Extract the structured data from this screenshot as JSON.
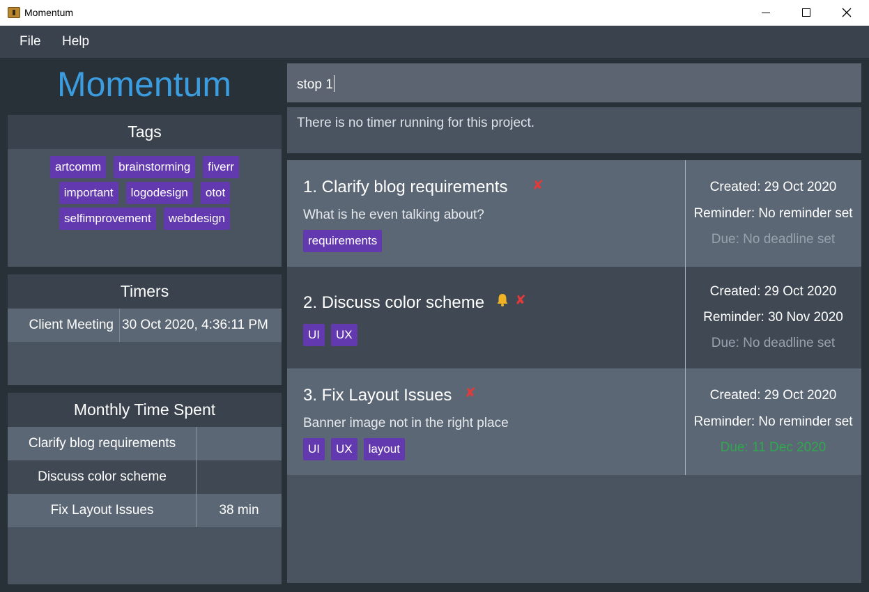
{
  "window": {
    "title": "Momentum"
  },
  "menu": {
    "items": [
      "File",
      "Help"
    ]
  },
  "brand": "Momentum",
  "tags_panel": {
    "title": "Tags",
    "rows": [
      [
        "artcomm",
        "brainstorming",
        "fiverr"
      ],
      [
        "important",
        "logodesign",
        "otot"
      ],
      [
        "selfimprovement",
        "webdesign"
      ]
    ]
  },
  "timers_panel": {
    "title": "Timers",
    "rows": [
      {
        "name": "Client Meeting",
        "time": "30 Oct 2020, 4:36:11 PM"
      }
    ]
  },
  "monthly_panel": {
    "title": "Monthly Time Spent",
    "rows": [
      {
        "name": "Clarify blog requirements",
        "time": ""
      },
      {
        "name": "Discuss color scheme",
        "time": ""
      },
      {
        "name": "Fix Layout Issues",
        "time": "38 min"
      }
    ]
  },
  "command": {
    "value": "stop 1"
  },
  "result": {
    "text": "There is no timer running for this project."
  },
  "projects": [
    {
      "title": "1. Clarify blog requirements",
      "description": "What is he even talking about?",
      "tags": [
        "requirements"
      ],
      "reminder_icon": false,
      "created": "Created: 29 Oct 2020",
      "reminder": "Reminder: No reminder set",
      "due": "Due: No deadline set",
      "due_color": "#98a2ad"
    },
    {
      "title": "2. Discuss color scheme",
      "description": "",
      "tags": [
        "UI",
        "UX"
      ],
      "reminder_icon": true,
      "created": "Created: 29 Oct 2020",
      "reminder": "Reminder: 30 Nov 2020",
      "due": "Due: No deadline set",
      "due_color": "#98a2ad"
    },
    {
      "title": "3. Fix Layout Issues",
      "description": "Banner image not in the right place",
      "tags": [
        "UI",
        "UX",
        "layout"
      ],
      "reminder_icon": false,
      "created": "Created: 29 Oct 2020",
      "reminder": "Reminder: No reminder set",
      "due": "Due: 11 Dec 2020",
      "due_color": "#2fa84f"
    }
  ],
  "colors": {
    "accent": "#3b9de0",
    "tag_chip": "#6339b0",
    "delete_cross": "#e03a3a",
    "bell": "#f0b323"
  }
}
